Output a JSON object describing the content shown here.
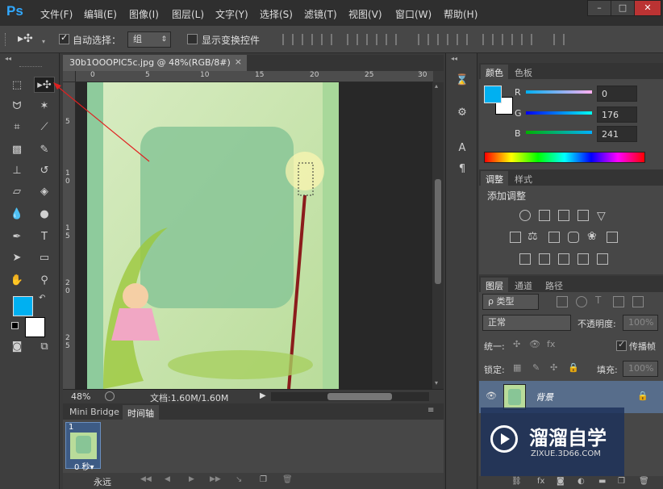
{
  "app": {
    "logo": "Ps"
  },
  "menu": [
    "文件(F)",
    "编辑(E)",
    "图像(I)",
    "图层(L)",
    "文字(Y)",
    "选择(S)",
    "滤镜(T)",
    "视图(V)",
    "窗口(W)",
    "帮助(H)"
  ],
  "window_controls": {
    "minimize": "–",
    "maximize": "□",
    "close": "✕"
  },
  "options": {
    "auto_select_label": "自动选择：",
    "auto_select_value": "组",
    "show_transform_label": "显示变换控件"
  },
  "document": {
    "tab_title": "30b1OOOPIC5c.jpg @ 48%(RGB/8#)",
    "tab_close": "×",
    "zoom": "48%",
    "doc_info": "文档:1.60M/1.60M",
    "ruler_top": [
      "0",
      "5",
      "10",
      "15",
      "20",
      "25",
      "30"
    ],
    "ruler_left": [
      "5",
      "1\n0",
      "1\n5",
      "2\n0",
      "2\n5"
    ]
  },
  "timeline": {
    "tabs": [
      "Mini Bridge",
      "时间轴"
    ],
    "frame_number": "1",
    "frame_delay": "0 秒▾",
    "loop": "永远"
  },
  "color_panel": {
    "tabs": [
      "颜色",
      "色板"
    ],
    "r_label": "R",
    "g_label": "G",
    "b_label": "B",
    "r": "0",
    "g": "176",
    "b": "241",
    "fg_color": "#00b0f1",
    "bg_color": "#ffffff"
  },
  "adjust_panel": {
    "tabs": [
      "调整",
      "样式"
    ],
    "title": "添加调整"
  },
  "layers_panel": {
    "tabs": [
      "图层",
      "通道",
      "路径"
    ],
    "kind_filter": "ρ 类型",
    "blend_mode": "正常",
    "opacity_label": "不透明度:",
    "opacity_value": "100%",
    "unify_label": "统一:",
    "propagate_label": "传播帧",
    "lock_label": "锁定:",
    "fill_label": "填充:",
    "fill_value": "100%",
    "layer_name": "背景"
  },
  "watermark": {
    "title": "溜溜自学",
    "url": "ZIXUE.3D66.COM"
  }
}
